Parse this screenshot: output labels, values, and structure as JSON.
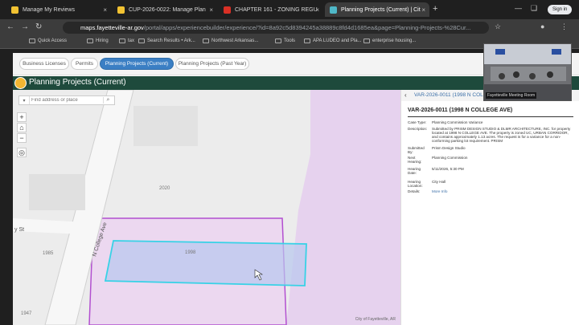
{
  "tabs": [
    {
      "title": "Manage My Reviews",
      "favicon_color": "#f1c232",
      "active": false
    },
    {
      "title": "CUP-2026-0022: Manage Plan",
      "favicon_color": "#f1c232",
      "active": false
    },
    {
      "title": "CHAPTER 161 - ZONING REGU",
      "favicon_color": "#d93025",
      "active": false
    },
    {
      "title": "Planning Projects (Current) | Cit",
      "favicon_color": "#4fb8c8",
      "active": true
    }
  ],
  "browser": {
    "url_host": "maps.fayetteville-ar.gov",
    "url_path": "/portal/apps/experiencebuilder/experience/?id=8a92c5d8394245a38889c8fd4d1685ea&page=Planning-Projects-%28Cur...",
    "sign_in": "Sign in"
  },
  "bookmarks": [
    "Quick Access",
    "Hiring",
    "tax",
    "Search Results • Ark...",
    "Northwest Arkansas...",
    "Tools",
    "APA LUDEO and Pla...",
    "enterprise housing..."
  ],
  "subnav": {
    "items": [
      "Business Licenses",
      "Permits",
      "Planning Projects (Current)",
      "Planning Projects (Past Year)"
    ],
    "active_index": 2
  },
  "app": {
    "title": "Planning Projects (Current)"
  },
  "map": {
    "search_placeholder": "Find address or place",
    "street_name": "N College Ave",
    "street_suffix": "y St",
    "parcel_labels": [
      "2020",
      "1985",
      "1998",
      "1947"
    ],
    "attribution": "City of Fayetteville, AR"
  },
  "panel": {
    "header": "VAR-2026-0011 (1998 N COLLEGE AVE)",
    "record_title": "VAR-2026-0011 (1998 N COLLEGE AVE)",
    "fields": [
      {
        "label": "Case Type:",
        "value": "Planning Commission Variance"
      },
      {
        "label": "Description:",
        "value": "Submitted by PRISM DESIGN STUDIO & DLMR ARCHITECTURE, INC. for property located at 1998 N COLLEGE AVE. The property is zoned UC, URBAN CORRIDOR, and contains approximately 1.13 acres. The request is for a variance for a non-conforming parking lot requirement. PRISM"
      },
      {
        "label": "Submitted By:",
        "value": "Prism Design Studio"
      },
      {
        "label": "Next Hearing:",
        "value": "Planning Commission"
      },
      {
        "label": "Hearing Date:",
        "value": "5/11/2026, 5:30 PM"
      },
      {
        "label": "Hearing Location:",
        "value": "City Hall"
      },
      {
        "label": "Details:",
        "value": "More Info"
      }
    ]
  },
  "video": {
    "caption": "Fayetteville Meeting Room"
  }
}
